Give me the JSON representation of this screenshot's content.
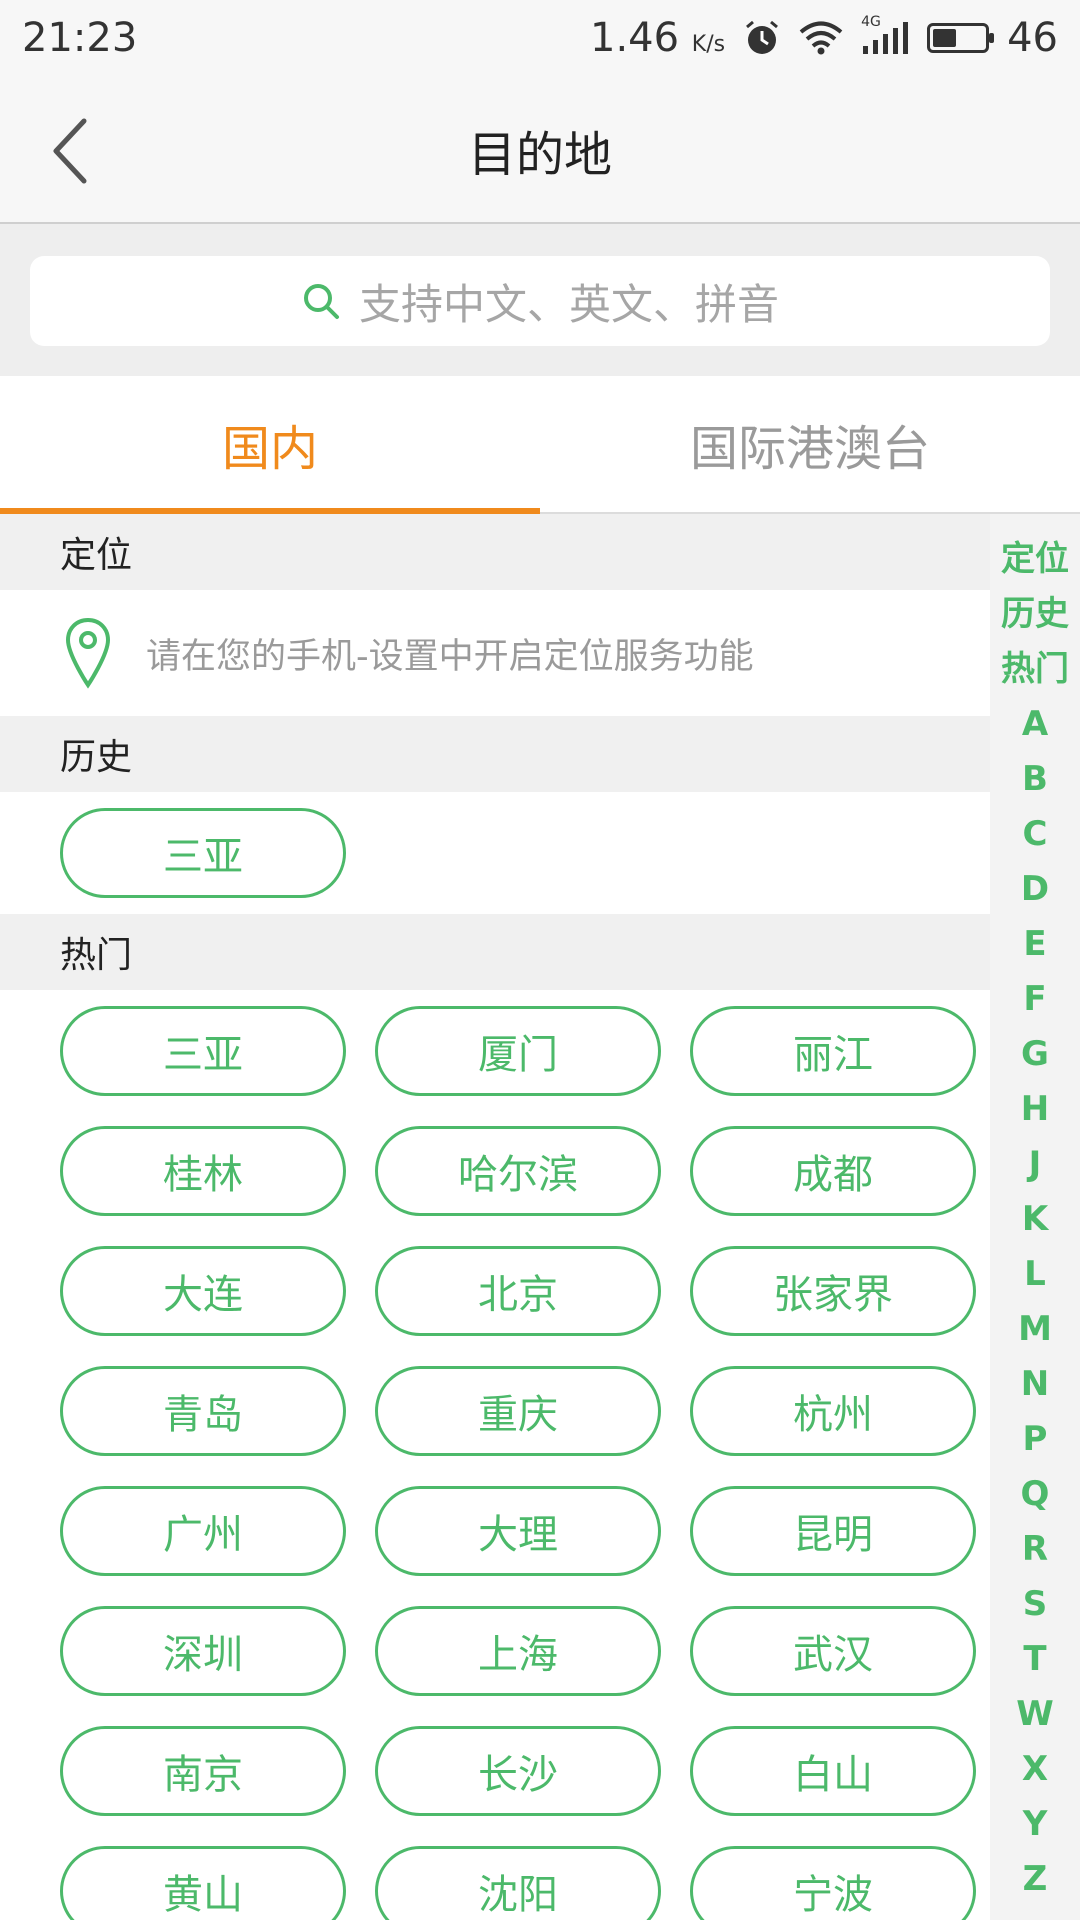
{
  "status_bar": {
    "time": "21:23",
    "speed": "1.46",
    "speed_unit": "K/s",
    "network": "4G",
    "battery": "46",
    "battery_level_percent": 46,
    "icons": [
      "alarm-icon",
      "wifi-icon",
      "signal-icon",
      "battery-icon"
    ]
  },
  "header": {
    "title": "目的地",
    "back_icon": "chevron-left-icon"
  },
  "search": {
    "placeholder": "支持中文、英文、拼音",
    "icon": "search-icon"
  },
  "tabs": [
    {
      "label": "国内",
      "active": true
    },
    {
      "label": "国际港澳台",
      "active": false
    }
  ],
  "sections": {
    "location": {
      "title": "定位",
      "message": "请在您的手机-设置中开启定位服务功能",
      "icon": "location-pin-icon"
    },
    "history": {
      "title": "历史",
      "items": [
        "三亚"
      ]
    },
    "hot": {
      "title": "热门",
      "items": [
        "三亚",
        "厦门",
        "丽江",
        "桂林",
        "哈尔滨",
        "成都",
        "大连",
        "北京",
        "张家界",
        "青岛",
        "重庆",
        "杭州",
        "广州",
        "大理",
        "昆明",
        "深圳",
        "上海",
        "武汉",
        "南京",
        "长沙",
        "白山",
        "黄山",
        "沈阳",
        "宁波"
      ]
    }
  },
  "index_bar": [
    "定位",
    "历史",
    "热门",
    "A",
    "B",
    "C",
    "D",
    "E",
    "F",
    "G",
    "H",
    "J",
    "K",
    "L",
    "M",
    "N",
    "P",
    "Q",
    "R",
    "S",
    "T",
    "W",
    "X",
    "Y",
    "Z"
  ],
  "colors": {
    "accent_orange": "#f08a1c",
    "accent_green": "#4cb96a",
    "section_bg": "#f0f0f0"
  }
}
